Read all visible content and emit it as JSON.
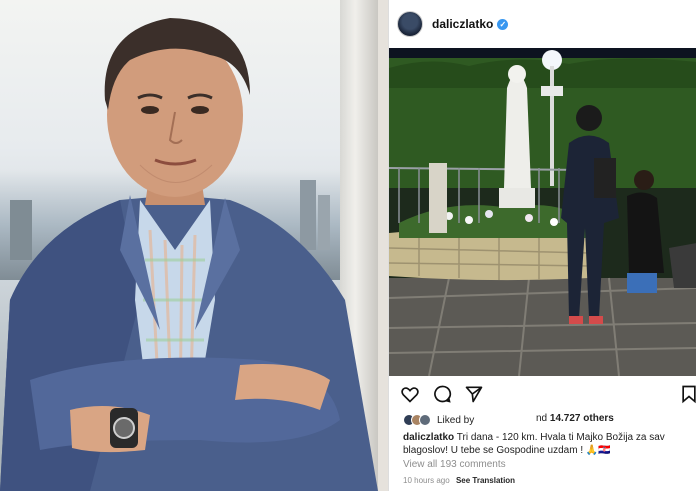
{
  "post": {
    "username": "daliczlatko",
    "verified_glyph": "✓",
    "liked_by_label": "Liked by",
    "liked_and": "nd",
    "likes_count": "14.727 others",
    "caption_user": "daliczlatko",
    "caption_text": "Tri dana - 120 km. Hvala ti Majko Božija za sav blagoslov! U tebe se Gospodine uzdam ! 🙏🇭🇷",
    "view_comments": "View all 193 comments",
    "time_ago": "10 hours ago",
    "see_translation": "See Translation"
  },
  "icons": {
    "like": "heart-icon",
    "comment": "comment-icon",
    "share": "share-icon",
    "save": "bookmark-icon"
  },
  "colors": {
    "verified": "#3897f0",
    "suit": "#4a5f8c",
    "hedge": "#2f5a22"
  }
}
